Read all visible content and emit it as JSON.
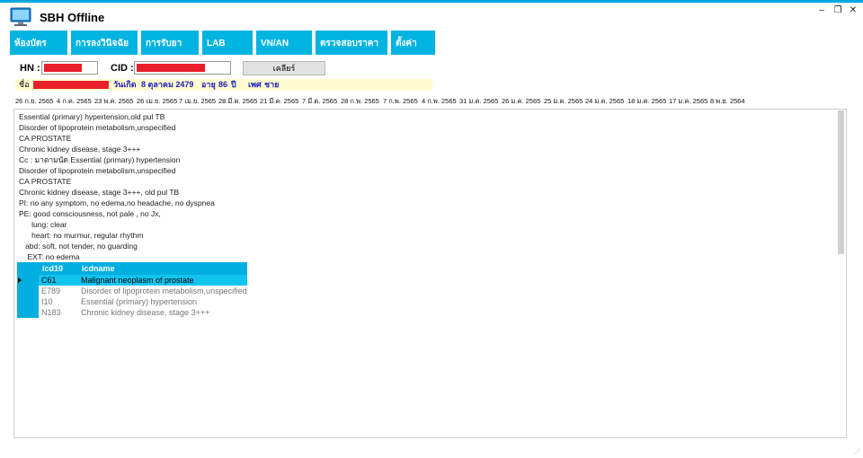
{
  "window": {
    "title": "SBH Offline",
    "controls": {
      "minimize": "–",
      "restore": "❐",
      "close": "✕"
    }
  },
  "colors": {
    "accent": "#00b4e0",
    "redaction": "#e8202a",
    "info_highlight": "#fffbd0",
    "info_text": "#2020b8"
  },
  "menu": {
    "items": [
      {
        "label": "ห้องบัตร"
      },
      {
        "label": "การลงวินิจฉัย"
      },
      {
        "label": "การรับยา"
      },
      {
        "label": "LAB"
      },
      {
        "label": "VN/AN"
      },
      {
        "label": "ตรวจสอบราคา"
      },
      {
        "label": "ตั้งค่า"
      }
    ]
  },
  "patient": {
    "hn_label": "HN :",
    "cid_label": "CID :",
    "clear_label": "เคลียร์",
    "name_label": "ชื่อ",
    "dob_label": "วันเกิด",
    "dob_value": "8 ตุลาคม 2479",
    "age_label": "อายุ",
    "age_value": "86",
    "age_unit": "ปี",
    "sex_label": "เพศ",
    "sex_value": "ชาย"
  },
  "visit_tabs": [
    "26 ก.ย. 2565",
    "4 ก.ค. 2565",
    "23 พ.ค. 2565",
    "26 เม.ย. 2565",
    "7 เม.ย. 2565",
    "28 มี.ค. 2565",
    "21 มี.ค. 2565",
    "7 มี.ค. 2565",
    "28 ก.พ. 2565",
    "7 ก.พ. 2565",
    "4 ก.พ. 2565",
    "31 ม.ค. 2565",
    "26 ม.ค. 2565",
    "25 ม.ค. 2565",
    "24 ม.ค. 2565",
    "18 ม.ค. 2565",
    "17 ม.ค. 2565",
    "8 พ.ย. 2564"
  ],
  "notes": [
    "Essential (primary) hypertension,old  pul TB",
    "Disorder of lipoprotein metabolism,unspecified",
    "CA PROSTATE",
    "Chronic kidney disease, stage 3+++",
    "Cc : มาตามนัด  Essential (primary) hypertension",
    "Disorder of lipoprotein metabolism,unspecified",
    "CA PROSTATE",
    "Chronic kidney disease, stage 3+++, old pul TB",
    "PI: no any symptom, no  edema,no  headache, no dyspnea",
    "PE: good consciousness, not pale , no Jx,",
    "      lung: clear",
    "      heart: no murmur, regular rhythm",
    "   abd: soft, not tender, no guarding",
    "    EXT: no edema"
  ],
  "diagnosis_grid": {
    "columns": [
      "icd10",
      "icdname"
    ],
    "rows": [
      {
        "icd10": "C61",
        "icdname": "Malignant neoplasm of prostate"
      },
      {
        "icd10": "E789",
        "icdname": "Disorder of lipoprotein metabolism,unspecified"
      },
      {
        "icd10": "I10",
        "icdname": "Essential (primary) hypertension"
      },
      {
        "icd10": "N183",
        "icdname": "Chronic kidney disease, stage 3+++"
      }
    ]
  }
}
